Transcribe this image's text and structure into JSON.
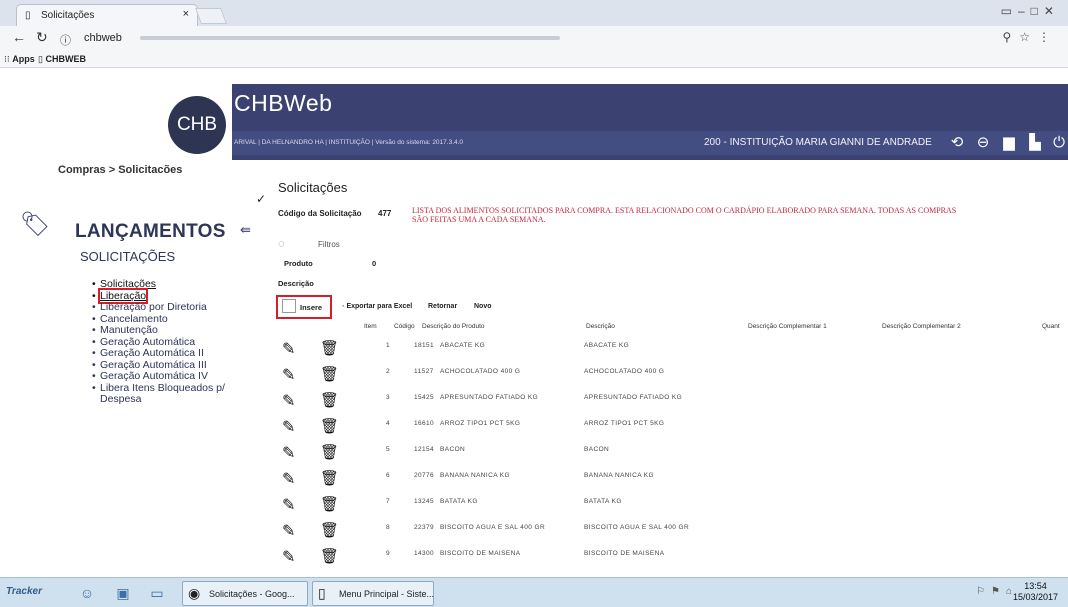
{
  "browser": {
    "tab_title": "Solicitações",
    "url_host": "chbweb",
    "bookmarks": [
      "Apps",
      "CHBWEB"
    ]
  },
  "header": {
    "logo_text": "CHB",
    "brand": "CHBWeb",
    "user_info": "ARIVAL | DA HELNANDRO HA | INSTITUIÇÃO | Versão do sistema: 2017.3.4.0",
    "institution": "200 - INSTITUIÇÃO MARIA GIANNI DE ANDRADE"
  },
  "breadcrumb": "Compras > Solicitacões",
  "sidebar": {
    "title": "LANÇAMENTOS",
    "subtitle": "SOLICITAÇÕES",
    "items": [
      "Solicitações",
      "Liberação",
      "Liberação por Diretoria",
      "Cancelamento",
      "Manutenção",
      "Geração Automática",
      "Geração Automática II",
      "Geração Automática III",
      "Geração Automática IV",
      "Libera Itens Bloqueados p/ Despesa"
    ]
  },
  "main": {
    "title": "Solicitações",
    "code_label": "Código da Solicitação",
    "code_value": "477",
    "note": "LISTA DOS ALIMENTOS SOLICITADOS PARA COMPRA. ESTA RELACIONADO COM O CARDÁPIO ELABORADO PARA SEMANA. TODAS AS COMPRAS SÃO FEITAS UMA A CADA SEMANA.",
    "filters_label": "Filtros",
    "produto_label": "Produto",
    "produto_value": "0",
    "descricao_label": "Descrição",
    "toolbar": {
      "insere": "Insere",
      "exportar": "Exportar para Excel",
      "retornar": "Retornar",
      "novo": "Novo"
    },
    "table": {
      "headers": [
        "Item",
        "Código",
        "Descrição do Produto",
        "Descrição",
        "Descrição Complementar 1",
        "Descrição Complementar 2",
        "Quant"
      ],
      "rows": [
        {
          "item": "1",
          "codigo": "18151",
          "produto": "ABACATE KG",
          "descricao": "ABACATE KG"
        },
        {
          "item": "2",
          "codigo": "11527",
          "produto": "ACHOCOLATADO 400 G",
          "descricao": "ACHOCOLATADO 400 G"
        },
        {
          "item": "3",
          "codigo": "15425",
          "produto": "APRESUNTADO FATIADO KG",
          "descricao": "APRESUNTADO FATIADO KG"
        },
        {
          "item": "4",
          "codigo": "16610",
          "produto": "ARROZ TIPO1 PCT 5KG",
          "descricao": "ARROZ TIPO1 PCT 5KG"
        },
        {
          "item": "5",
          "codigo": "12154",
          "produto": "BACON",
          "descricao": "BACON"
        },
        {
          "item": "6",
          "codigo": "20776",
          "produto": "BANANA NANICA KG",
          "descricao": "BANANA NANICA KG"
        },
        {
          "item": "7",
          "codigo": "13245",
          "produto": "BATATA KG",
          "descricao": "BATATA KG"
        },
        {
          "item": "8",
          "codigo": "22379",
          "produto": "BISCOITO AGUA E SAL 400 GR",
          "descricao": "BISCOITO AGUA E SAL 400 GR"
        },
        {
          "item": "9",
          "codigo": "14300",
          "produto": "BISCOITO DE MAISENA",
          "descricao": "BISCOITO DE MAISENA"
        }
      ]
    }
  },
  "taskbar": {
    "start": "Tracker",
    "tasks": [
      "Solicitações - Goog...",
      "Menu Principal - Siste..."
    ],
    "time": "13:54",
    "date": "15/03/2017"
  }
}
